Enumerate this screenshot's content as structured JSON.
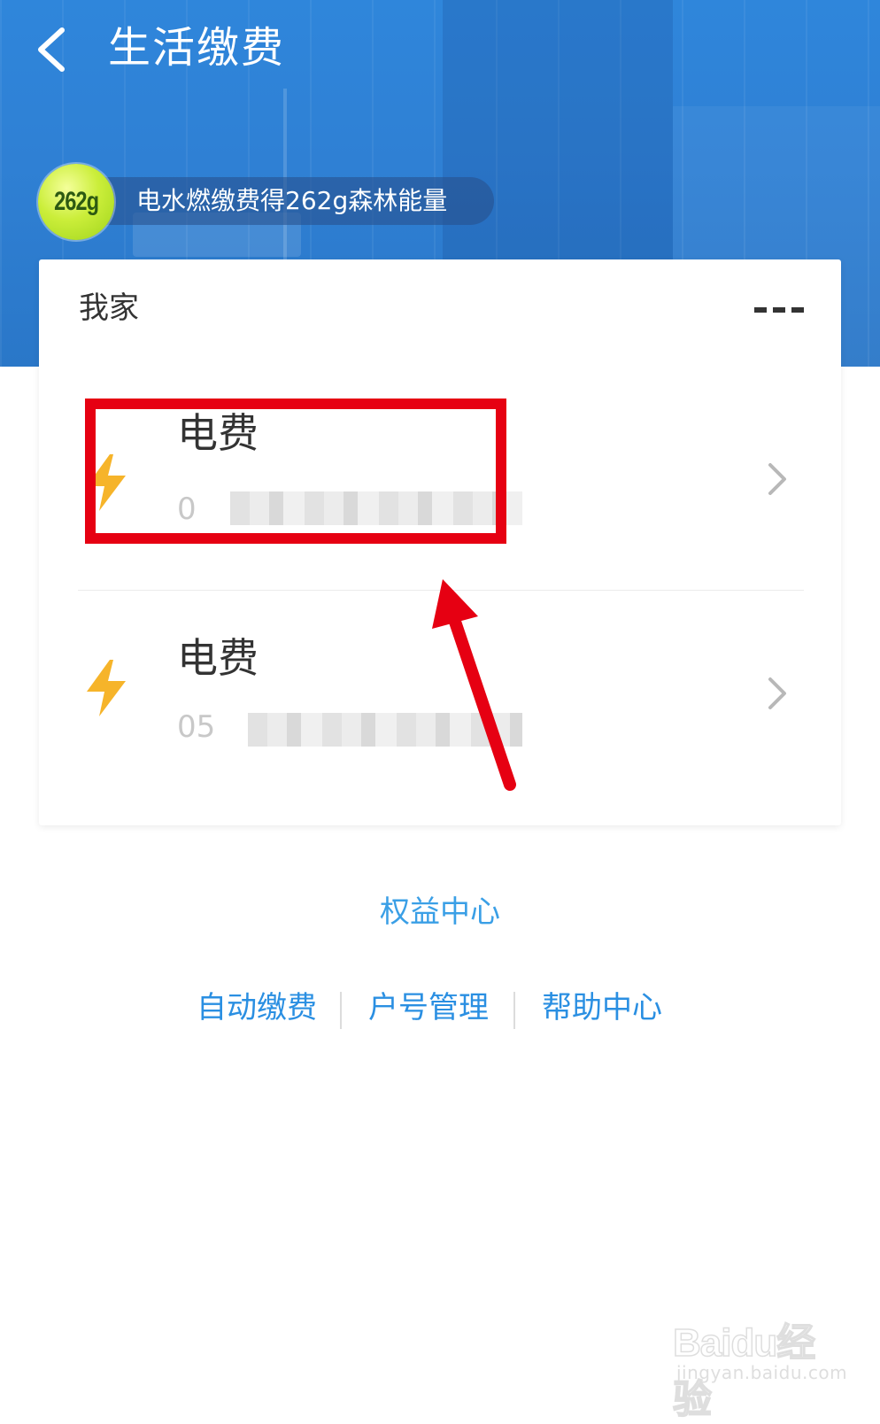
{
  "header": {
    "title": "生活缴费",
    "back_icon": "chevron-left-icon"
  },
  "banner": {
    "energy_badge": "262g",
    "energy_text": "电水燃缴费得262g森林能量",
    "badge_color": "#c7ec3a"
  },
  "card": {
    "title": "我家",
    "more_icon": "more-dots-icon",
    "bills": [
      {
        "name": "电费",
        "account": "0",
        "icon": "lightning-bolt-icon"
      },
      {
        "name": "电费",
        "account": "05",
        "icon": "lightning-bolt-icon"
      }
    ]
  },
  "links": {
    "benefits": "权益中心",
    "auto_pay": "自动缴费",
    "account_manage": "户号管理",
    "help": "帮助中心"
  },
  "annotation": {
    "highlight_color": "#e60012"
  },
  "watermark": {
    "logo": "Baidu经验",
    "url": "jingyan.baidu.com"
  },
  "colors": {
    "header_blue": "#2f84d8",
    "link_blue": "#2a8fe2",
    "bolt_yellow": "#f6b42a"
  }
}
